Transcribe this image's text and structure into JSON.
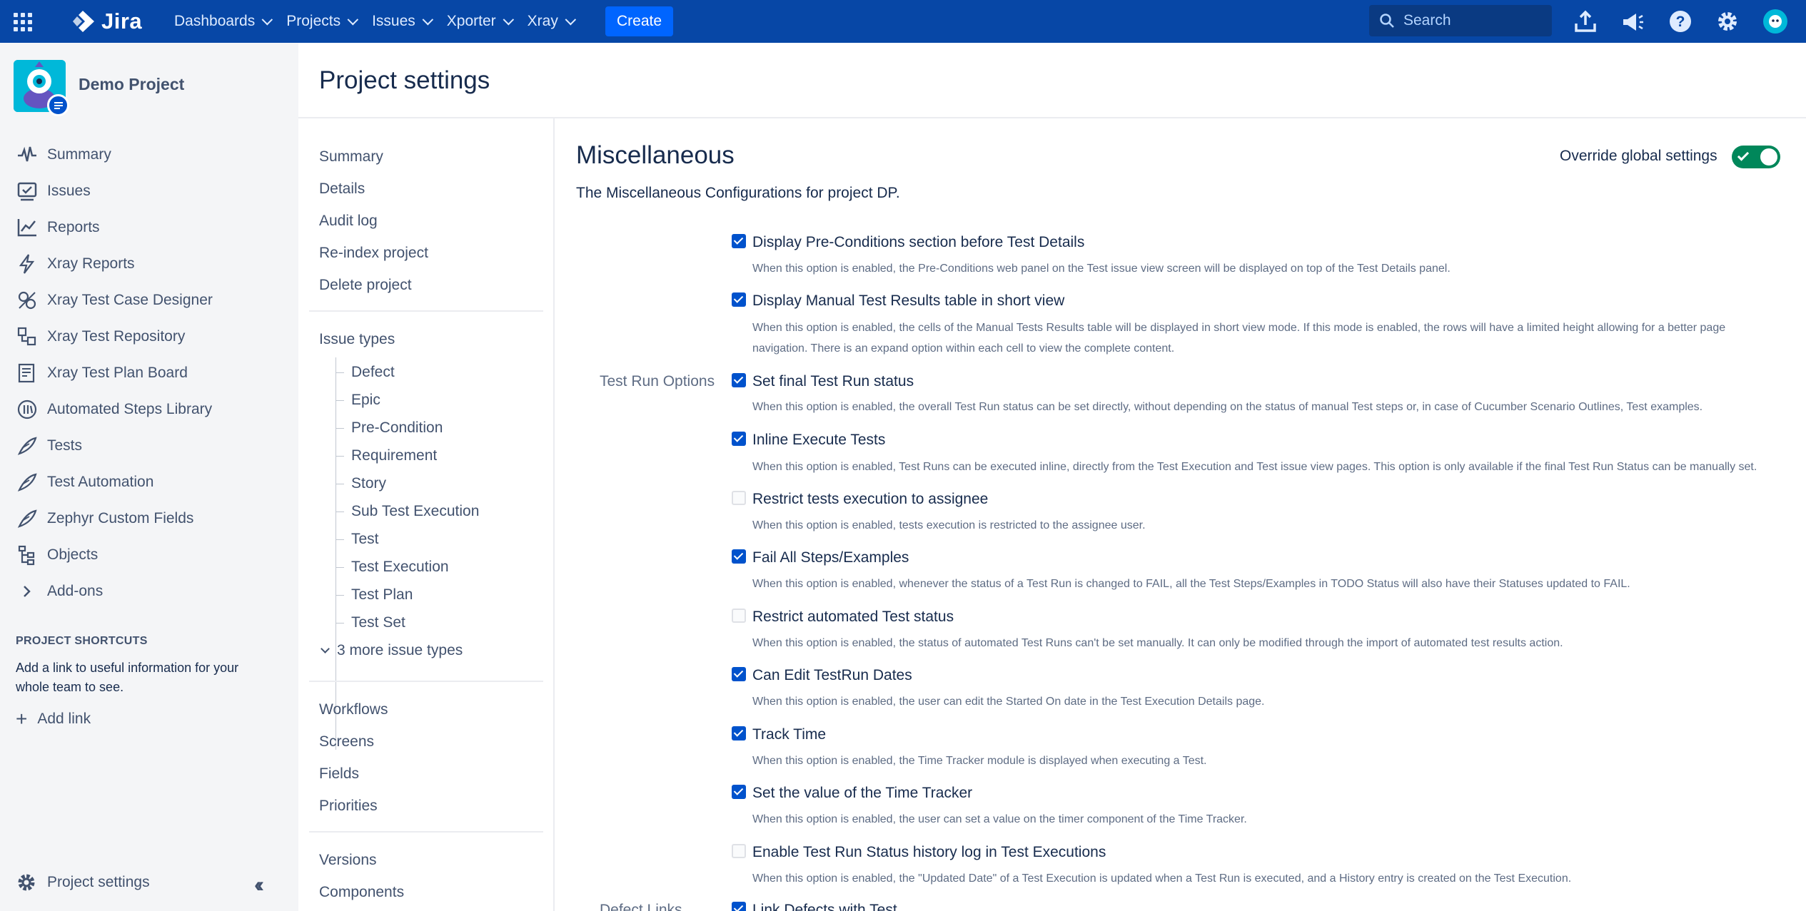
{
  "topnav": {
    "logo_text": "Jira",
    "items": [
      {
        "label": "Dashboards"
      },
      {
        "label": "Projects"
      },
      {
        "label": "Issues"
      },
      {
        "label": "Xporter"
      },
      {
        "label": "Xray"
      }
    ],
    "create_label": "Create",
    "search_placeholder": "Search",
    "icons": [
      "upload-icon",
      "megaphone-icon",
      "help-icon",
      "settings-icon",
      "user-avatar"
    ]
  },
  "sidebar": {
    "project_name": "Demo Project",
    "items": [
      {
        "label": "Summary",
        "icon": "pulse-icon"
      },
      {
        "label": "Issues",
        "icon": "issues-icon"
      },
      {
        "label": "Reports",
        "icon": "chart-icon"
      },
      {
        "label": "Xray Reports",
        "icon": "lightning-icon"
      },
      {
        "label": "Xray Test Case Designer",
        "icon": "designer-icon"
      },
      {
        "label": "Xray Test Repository",
        "icon": "repository-icon"
      },
      {
        "label": "Xray Test Plan Board",
        "icon": "board-icon"
      },
      {
        "label": "Automated Steps Library",
        "icon": "library-icon"
      },
      {
        "label": "Tests",
        "icon": "feather-icon"
      },
      {
        "label": "Test Automation",
        "icon": "feather-icon"
      },
      {
        "label": "Zephyr Custom Fields",
        "icon": "feather-icon"
      },
      {
        "label": "Objects",
        "icon": "hierarchy-icon"
      },
      {
        "label": "Add-ons",
        "icon": "chevron-right-icon"
      }
    ],
    "shortcuts_title": "PROJECT SHORTCUTS",
    "shortcuts_text": "Add a link to useful information for your whole team to see.",
    "add_link": "Add link",
    "project_settings": "Project settings"
  },
  "page": {
    "title": "Project settings"
  },
  "settings_nav": {
    "top_links": [
      "Summary",
      "Details",
      "Audit log",
      "Re-index project",
      "Delete project"
    ],
    "issue_types_label": "Issue types",
    "issue_types": [
      "Defect",
      "Epic",
      "Pre-Condition",
      "Requirement",
      "Story",
      "Sub Test Execution",
      "Test",
      "Test Execution",
      "Test Plan",
      "Test Set"
    ],
    "more_issue_types": "3 more issue types",
    "config_links": [
      "Workflows",
      "Screens",
      "Fields",
      "Priorities"
    ],
    "bottom_links": [
      "Versions",
      "Components"
    ]
  },
  "main": {
    "title": "Miscellaneous",
    "override_label": "Override global settings",
    "override_enabled": true,
    "description": "The Miscellaneous Configurations for project DP.",
    "test_run_group": "Test Run Options",
    "defect_group": "Defect Links",
    "options": [
      {
        "label": "Display Pre-Conditions section before Test Details",
        "checked": true,
        "desc": "When this option is enabled, the Pre-Conditions web panel on the Test issue view screen will be displayed on top of the Test Details panel."
      },
      {
        "label": "Display Manual Test Results table in short view",
        "checked": true,
        "desc": "When this option is enabled, the cells of the Manual Tests Results table will be displayed in short view mode. If this mode is enabled, the rows will have a limited height allowing for a better page navigation. There is an expand option within each cell to view the complete content."
      },
      {
        "label": "Set final Test Run status",
        "checked": true,
        "desc": "When this option is enabled, the overall Test Run status can be set directly, without depending on the status of manual Test steps or, in case of Cucumber Scenario Outlines, Test examples."
      },
      {
        "label": "Inline Execute Tests",
        "checked": true,
        "desc": "When this option is enabled, Test Runs can be executed inline, directly from the Test Execution and Test issue view pages. This option is only available if the final Test Run Status can be manually set."
      },
      {
        "label": "Restrict tests execution to assignee",
        "checked": false,
        "desc": "When this option is enabled, tests execution is restricted to the assignee user."
      },
      {
        "label": "Fail All Steps/Examples",
        "checked": true,
        "desc": "When this option is enabled, whenever the status of a Test Run is changed to FAIL, all the Test Steps/Examples in TODO Status will also have their Statuses updated to FAIL."
      },
      {
        "label": "Restrict automated Test status",
        "checked": false,
        "desc": "When this option is enabled, the status of automated Test Runs can't be set manually. It can only be modified through the import of automated test results action."
      },
      {
        "label": "Can Edit TestRun Dates",
        "checked": true,
        "desc": "When this option is enabled, the user can edit the Started On date in the Test Execution Details page."
      },
      {
        "label": "Track Time",
        "checked": true,
        "desc": "When this option is enabled, the Time Tracker module is displayed when executing a Test."
      },
      {
        "label": "Set the value of the Time Tracker",
        "checked": true,
        "desc": "When this option is enabled, the user can set a value on the timer component of the Time Tracker."
      },
      {
        "label": "Enable Test Run Status history log in Test Executions",
        "checked": false,
        "desc": "When this option is enabled, the \"Updated Date\" of a Test Execution is updated when a Test Run is executed, and a History entry is created on the Test Execution."
      },
      {
        "label": "Link Defects with Test",
        "checked": true,
        "desc": ""
      }
    ]
  }
}
